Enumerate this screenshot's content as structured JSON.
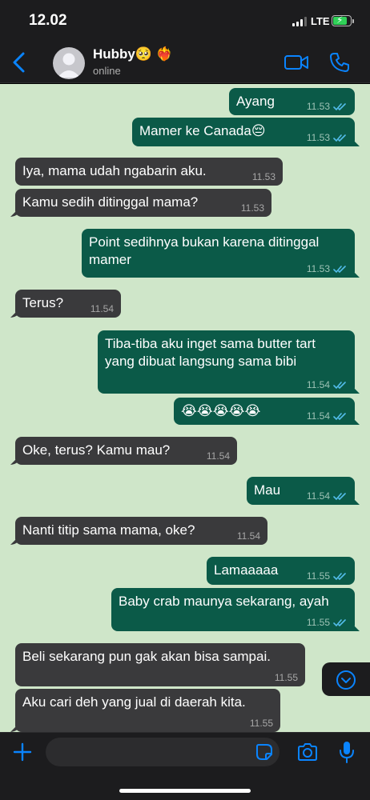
{
  "status_bar": {
    "time": "12.02",
    "network": "LTE"
  },
  "header": {
    "contact_name": "Hubby🥺 ❤️‍🔥",
    "contact_status": "online"
  },
  "messages": [
    {
      "dir": "out",
      "text": "Ayang",
      "time": "11.53"
    },
    {
      "dir": "out",
      "text": "Mamer ke Canada😔",
      "time": "11.53"
    },
    {
      "dir": "in",
      "text": "Iya, mama udah ngabarin aku.",
      "time": "11.53"
    },
    {
      "dir": "in",
      "text": "Kamu sedih ditinggal mama?",
      "time": "11.53"
    },
    {
      "dir": "out",
      "text": "Point sedihnya bukan karena ditinggal mamer",
      "time": "11.53"
    },
    {
      "dir": "in",
      "text": "Terus?",
      "time": "11.54"
    },
    {
      "dir": "out",
      "text": "Tiba-tiba aku inget sama butter tart yang dibuat langsung sama bibi",
      "time": "11.54"
    },
    {
      "dir": "out",
      "text": "😭😭😭😭😭",
      "time": "11.54"
    },
    {
      "dir": "in",
      "text": "Oke, terus? Kamu mau?",
      "time": "11.54"
    },
    {
      "dir": "out",
      "text": "Mau",
      "time": "11.54"
    },
    {
      "dir": "in",
      "text": "Nanti titip sama mama, oke?",
      "time": "11.54"
    },
    {
      "dir": "out",
      "text": "Lamaaaaa",
      "time": "11.55"
    },
    {
      "dir": "out",
      "text": "Baby crab maunya sekarang, ayah",
      "time": "11.55"
    },
    {
      "dir": "in",
      "text": "Beli sekarang pun gak akan bisa sampai.",
      "time": "11.55"
    },
    {
      "dir": "in",
      "text": "Aku cari deh yang jual di daerah kita.",
      "time": "11.55"
    }
  ],
  "input": {
    "placeholder": "",
    "value": ""
  },
  "icons": {
    "back": "chevron-left-icon",
    "video": "video-camera-icon",
    "call": "phone-icon",
    "scroll": "chevron-down-circle-icon",
    "plus": "plus-icon",
    "sticker": "sticker-icon",
    "camera": "camera-icon",
    "mic": "microphone-icon"
  },
  "colors": {
    "accent": "#0a84ff",
    "chat_background": "#cfe6c9",
    "bubble_in": "#3a3a3c",
    "bubble_out": "#0b5a48",
    "read_ticks": "#53bdeb"
  }
}
